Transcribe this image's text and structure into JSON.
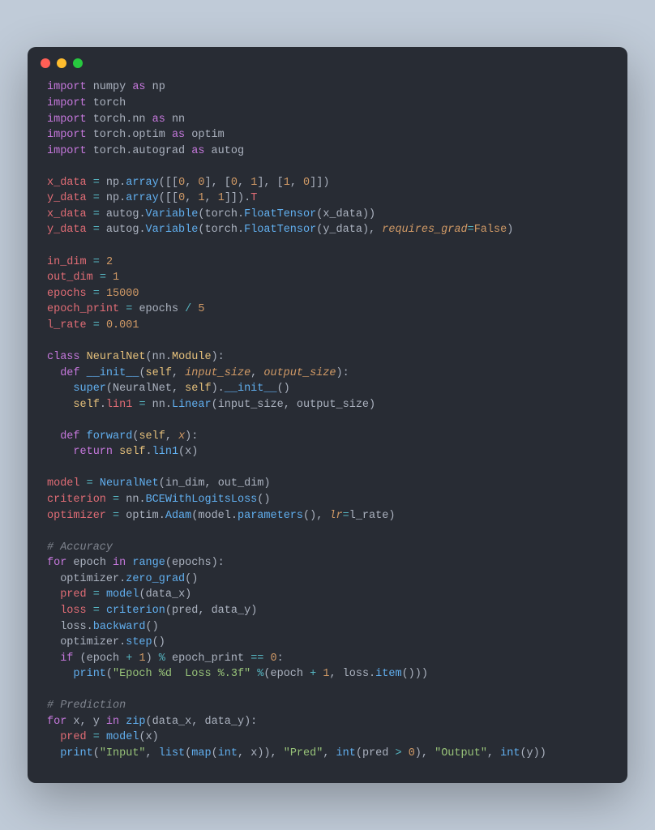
{
  "titlebar": {
    "buttons": [
      "close",
      "minimize",
      "maximize"
    ]
  },
  "code": {
    "lines": [
      [
        [
          "kw",
          "import"
        ],
        [
          "",
          " numpy "
        ],
        [
          "kw",
          "as"
        ],
        [
          "",
          " np"
        ]
      ],
      [
        [
          "kw",
          "import"
        ],
        [
          "",
          " torch"
        ]
      ],
      [
        [
          "kw",
          "import"
        ],
        [
          "",
          " torch"
        ],
        [
          "punc",
          "."
        ],
        [
          "",
          "nn "
        ],
        [
          "kw",
          "as"
        ],
        [
          "",
          " nn"
        ]
      ],
      [
        [
          "kw",
          "import"
        ],
        [
          "",
          " torch"
        ],
        [
          "punc",
          "."
        ],
        [
          "",
          "optim "
        ],
        [
          "kw",
          "as"
        ],
        [
          "",
          " optim"
        ]
      ],
      [
        [
          "kw",
          "import"
        ],
        [
          "",
          " torch"
        ],
        [
          "punc",
          "."
        ],
        [
          "",
          "autograd "
        ],
        [
          "kw",
          "as"
        ],
        [
          "",
          " autog"
        ]
      ],
      [],
      [
        [
          "var",
          "x_data"
        ],
        [
          "",
          " "
        ],
        [
          "op",
          "="
        ],
        [
          "",
          " np"
        ],
        [
          "punc",
          "."
        ],
        [
          "fn",
          "array"
        ],
        [
          "punc",
          "([["
        ],
        [
          "num",
          "0"
        ],
        [
          "punc",
          ", "
        ],
        [
          "num",
          "0"
        ],
        [
          "punc",
          "], ["
        ],
        [
          "num",
          "0"
        ],
        [
          "punc",
          ", "
        ],
        [
          "num",
          "1"
        ],
        [
          "punc",
          "], ["
        ],
        [
          "num",
          "1"
        ],
        [
          "punc",
          ", "
        ],
        [
          "num",
          "0"
        ],
        [
          "punc",
          "]])"
        ]
      ],
      [
        [
          "var",
          "y_data"
        ],
        [
          "",
          " "
        ],
        [
          "op",
          "="
        ],
        [
          "",
          " np"
        ],
        [
          "punc",
          "."
        ],
        [
          "fn",
          "array"
        ],
        [
          "punc",
          "([["
        ],
        [
          "num",
          "0"
        ],
        [
          "punc",
          ", "
        ],
        [
          "num",
          "1"
        ],
        [
          "punc",
          ", "
        ],
        [
          "num",
          "1"
        ],
        [
          "punc",
          "]])."
        ],
        [
          "var",
          "T"
        ]
      ],
      [
        [
          "var",
          "x_data"
        ],
        [
          "",
          " "
        ],
        [
          "op",
          "="
        ],
        [
          "",
          " autog"
        ],
        [
          "punc",
          "."
        ],
        [
          "fn",
          "Variable"
        ],
        [
          "punc",
          "("
        ],
        [
          "",
          "torch"
        ],
        [
          "punc",
          "."
        ],
        [
          "fn",
          "FloatTensor"
        ],
        [
          "punc",
          "("
        ],
        [
          "",
          "x_data"
        ],
        [
          "punc",
          "))"
        ]
      ],
      [
        [
          "var",
          "y_data"
        ],
        [
          "",
          " "
        ],
        [
          "op",
          "="
        ],
        [
          "",
          " autog"
        ],
        [
          "punc",
          "."
        ],
        [
          "fn",
          "Variable"
        ],
        [
          "punc",
          "("
        ],
        [
          "",
          "torch"
        ],
        [
          "punc",
          "."
        ],
        [
          "fn",
          "FloatTensor"
        ],
        [
          "punc",
          "("
        ],
        [
          "",
          "y_data"
        ],
        [
          "punc",
          "), "
        ],
        [
          "param",
          "requires_grad"
        ],
        [
          "op",
          "="
        ],
        [
          "bool",
          "False"
        ],
        [
          "punc",
          ")"
        ]
      ],
      [],
      [
        [
          "var",
          "in_dim"
        ],
        [
          "",
          " "
        ],
        [
          "op",
          "="
        ],
        [
          "",
          " "
        ],
        [
          "num",
          "2"
        ]
      ],
      [
        [
          "var",
          "out_dim"
        ],
        [
          "",
          " "
        ],
        [
          "op",
          "="
        ],
        [
          "",
          " "
        ],
        [
          "num",
          "1"
        ]
      ],
      [
        [
          "var",
          "epochs"
        ],
        [
          "",
          " "
        ],
        [
          "op",
          "="
        ],
        [
          "",
          " "
        ],
        [
          "num",
          "15000"
        ]
      ],
      [
        [
          "var",
          "epoch_print"
        ],
        [
          "",
          " "
        ],
        [
          "op",
          "="
        ],
        [
          "",
          " epochs "
        ],
        [
          "op",
          "/"
        ],
        [
          "",
          " "
        ],
        [
          "num",
          "5"
        ]
      ],
      [
        [
          "var",
          "l_rate"
        ],
        [
          "",
          " "
        ],
        [
          "op",
          "="
        ],
        [
          "",
          " "
        ],
        [
          "num",
          "0.001"
        ]
      ],
      [],
      [
        [
          "kw",
          "class"
        ],
        [
          "",
          " "
        ],
        [
          "cls",
          "NeuralNet"
        ],
        [
          "punc",
          "("
        ],
        [
          "",
          "nn"
        ],
        [
          "punc",
          "."
        ],
        [
          "cls",
          "Module"
        ],
        [
          "punc",
          "):"
        ]
      ],
      [
        [
          "",
          "  "
        ],
        [
          "kw",
          "def"
        ],
        [
          "",
          " "
        ],
        [
          "fn",
          "__init__"
        ],
        [
          "punc",
          "("
        ],
        [
          "self",
          "self"
        ],
        [
          "punc",
          ", "
        ],
        [
          "param",
          "input_size"
        ],
        [
          "punc",
          ", "
        ],
        [
          "param",
          "output_size"
        ],
        [
          "punc",
          "):"
        ]
      ],
      [
        [
          "",
          "    "
        ],
        [
          "fn",
          "super"
        ],
        [
          "punc",
          "("
        ],
        [
          "",
          "NeuralNet"
        ],
        [
          "punc",
          ", "
        ],
        [
          "self",
          "self"
        ],
        [
          "punc",
          ")."
        ],
        [
          "fn",
          "__init__"
        ],
        [
          "punc",
          "()"
        ]
      ],
      [
        [
          "",
          "    "
        ],
        [
          "self",
          "self"
        ],
        [
          "punc",
          "."
        ],
        [
          "var",
          "lin1"
        ],
        [
          "",
          " "
        ],
        [
          "op",
          "="
        ],
        [
          "",
          " nn"
        ],
        [
          "punc",
          "."
        ],
        [
          "fn",
          "Linear"
        ],
        [
          "punc",
          "("
        ],
        [
          "",
          "input_size"
        ],
        [
          "punc",
          ", "
        ],
        [
          "",
          "output_size"
        ],
        [
          "punc",
          ")"
        ]
      ],
      [],
      [
        [
          "",
          "  "
        ],
        [
          "kw",
          "def"
        ],
        [
          "",
          " "
        ],
        [
          "fn",
          "forward"
        ],
        [
          "punc",
          "("
        ],
        [
          "self",
          "self"
        ],
        [
          "punc",
          ", "
        ],
        [
          "param",
          "x"
        ],
        [
          "punc",
          "):"
        ]
      ],
      [
        [
          "",
          "    "
        ],
        [
          "kw",
          "return"
        ],
        [
          "",
          " "
        ],
        [
          "self",
          "self"
        ],
        [
          "punc",
          "."
        ],
        [
          "fn",
          "lin1"
        ],
        [
          "punc",
          "("
        ],
        [
          "",
          "x"
        ],
        [
          "punc",
          ")"
        ]
      ],
      [],
      [
        [
          "var",
          "model"
        ],
        [
          "",
          " "
        ],
        [
          "op",
          "="
        ],
        [
          "",
          " "
        ],
        [
          "fn",
          "NeuralNet"
        ],
        [
          "punc",
          "("
        ],
        [
          "",
          "in_dim"
        ],
        [
          "punc",
          ", "
        ],
        [
          "",
          "out_dim"
        ],
        [
          "punc",
          ")"
        ]
      ],
      [
        [
          "var",
          "criterion"
        ],
        [
          "",
          " "
        ],
        [
          "op",
          "="
        ],
        [
          "",
          " nn"
        ],
        [
          "punc",
          "."
        ],
        [
          "fn",
          "BCEWithLogitsLoss"
        ],
        [
          "punc",
          "()"
        ]
      ],
      [
        [
          "var",
          "optimizer"
        ],
        [
          "",
          " "
        ],
        [
          "op",
          "="
        ],
        [
          "",
          " optim"
        ],
        [
          "punc",
          "."
        ],
        [
          "fn",
          "Adam"
        ],
        [
          "punc",
          "("
        ],
        [
          "",
          "model"
        ],
        [
          "punc",
          "."
        ],
        [
          "fn",
          "parameters"
        ],
        [
          "punc",
          "(), "
        ],
        [
          "param",
          "lr"
        ],
        [
          "op",
          "="
        ],
        [
          "",
          "l_rate"
        ],
        [
          "punc",
          ")"
        ]
      ],
      [],
      [
        [
          "comment",
          "# Accuracy"
        ]
      ],
      [
        [
          "kw",
          "for"
        ],
        [
          "",
          " epoch "
        ],
        [
          "kw",
          "in"
        ],
        [
          "",
          " "
        ],
        [
          "fn",
          "range"
        ],
        [
          "punc",
          "("
        ],
        [
          "",
          "epochs"
        ],
        [
          "punc",
          "):"
        ]
      ],
      [
        [
          "",
          "  optimizer"
        ],
        [
          "punc",
          "."
        ],
        [
          "fn",
          "zero_grad"
        ],
        [
          "punc",
          "()"
        ]
      ],
      [
        [
          "",
          "  "
        ],
        [
          "var",
          "pred"
        ],
        [
          "",
          " "
        ],
        [
          "op",
          "="
        ],
        [
          "",
          " "
        ],
        [
          "fn",
          "model"
        ],
        [
          "punc",
          "("
        ],
        [
          "",
          "data_x"
        ],
        [
          "punc",
          ")"
        ]
      ],
      [
        [
          "",
          "  "
        ],
        [
          "var",
          "loss"
        ],
        [
          "",
          " "
        ],
        [
          "op",
          "="
        ],
        [
          "",
          " "
        ],
        [
          "fn",
          "criterion"
        ],
        [
          "punc",
          "("
        ],
        [
          "",
          "pred"
        ],
        [
          "punc",
          ", "
        ],
        [
          "",
          "data_y"
        ],
        [
          "punc",
          ")"
        ]
      ],
      [
        [
          "",
          "  loss"
        ],
        [
          "punc",
          "."
        ],
        [
          "fn",
          "backward"
        ],
        [
          "punc",
          "()"
        ]
      ],
      [
        [
          "",
          "  optimizer"
        ],
        [
          "punc",
          "."
        ],
        [
          "fn",
          "step"
        ],
        [
          "punc",
          "()"
        ]
      ],
      [
        [
          "",
          "  "
        ],
        [
          "kw",
          "if"
        ],
        [
          "",
          " "
        ],
        [
          "punc",
          "("
        ],
        [
          "",
          "epoch "
        ],
        [
          "op",
          "+"
        ],
        [
          "",
          " "
        ],
        [
          "num",
          "1"
        ],
        [
          "punc",
          ") "
        ],
        [
          "op",
          "%"
        ],
        [
          "",
          " epoch_print "
        ],
        [
          "op",
          "=="
        ],
        [
          "",
          " "
        ],
        [
          "num",
          "0"
        ],
        [
          "punc",
          ":"
        ]
      ],
      [
        [
          "",
          "    "
        ],
        [
          "fn",
          "print"
        ],
        [
          "punc",
          "("
        ],
        [
          "str",
          "\"Epoch %d  Loss %.3f\""
        ],
        [
          "",
          " "
        ],
        [
          "op",
          "%"
        ],
        [
          "punc",
          "("
        ],
        [
          "",
          "epoch "
        ],
        [
          "op",
          "+"
        ],
        [
          "",
          " "
        ],
        [
          "num",
          "1"
        ],
        [
          "punc",
          ", "
        ],
        [
          "",
          "loss"
        ],
        [
          "punc",
          "."
        ],
        [
          "fn",
          "item"
        ],
        [
          "punc",
          "()))"
        ]
      ],
      [],
      [
        [
          "comment",
          "# Prediction"
        ]
      ],
      [
        [
          "kw",
          "for"
        ],
        [
          "",
          " x"
        ],
        [
          "punc",
          ", "
        ],
        [
          "",
          "y "
        ],
        [
          "kw",
          "in"
        ],
        [
          "",
          " "
        ],
        [
          "fn",
          "zip"
        ],
        [
          "punc",
          "("
        ],
        [
          "",
          "data_x"
        ],
        [
          "punc",
          ", "
        ],
        [
          "",
          "data_y"
        ],
        [
          "punc",
          "):"
        ]
      ],
      [
        [
          "",
          "  "
        ],
        [
          "var",
          "pred"
        ],
        [
          "",
          " "
        ],
        [
          "op",
          "="
        ],
        [
          "",
          " "
        ],
        [
          "fn",
          "model"
        ],
        [
          "punc",
          "("
        ],
        [
          "",
          "x"
        ],
        [
          "punc",
          ")"
        ]
      ],
      [
        [
          "",
          "  "
        ],
        [
          "fn",
          "print"
        ],
        [
          "punc",
          "("
        ],
        [
          "str",
          "\"Input\""
        ],
        [
          "punc",
          ", "
        ],
        [
          "fn",
          "list"
        ],
        [
          "punc",
          "("
        ],
        [
          "fn",
          "map"
        ],
        [
          "punc",
          "("
        ],
        [
          "fn",
          "int"
        ],
        [
          "punc",
          ", "
        ],
        [
          "",
          "x"
        ],
        [
          "punc",
          ")), "
        ],
        [
          "str",
          "\"Pred\""
        ],
        [
          "punc",
          ", "
        ],
        [
          "fn",
          "int"
        ],
        [
          "punc",
          "("
        ],
        [
          "",
          "pred "
        ],
        [
          "op",
          ">"
        ],
        [
          "",
          " "
        ],
        [
          "num",
          "0"
        ],
        [
          "punc",
          "), "
        ],
        [
          "str",
          "\"Output\""
        ],
        [
          "punc",
          ", "
        ],
        [
          "fn",
          "int"
        ],
        [
          "punc",
          "("
        ],
        [
          "",
          "y"
        ],
        [
          "punc",
          "))"
        ]
      ]
    ]
  }
}
